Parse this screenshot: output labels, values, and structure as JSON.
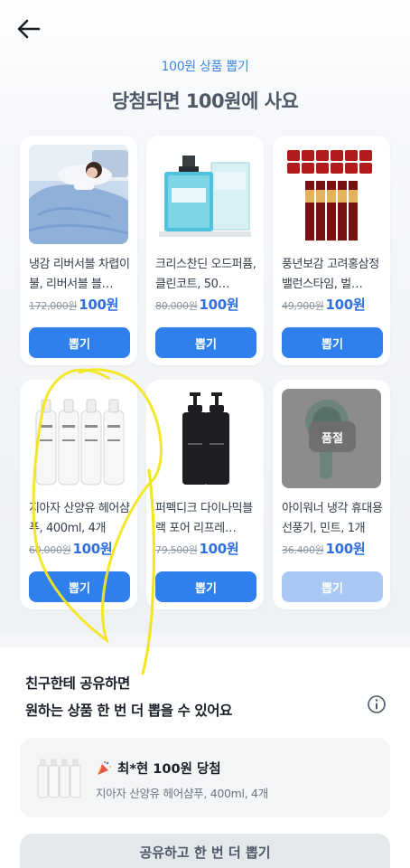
{
  "header": {
    "back_icon": "arrow-left-icon",
    "subtitle": "100원 상품 뽑기",
    "title": "당첨되면 100원에 사요"
  },
  "products": [
    {
      "name": "냉감 리버서블 차렵이불, 리버서블 블…",
      "original_price": "172,000원",
      "sale_price": "100원",
      "button": "뽑기",
      "sold_out": false
    },
    {
      "name": "크리스찬딘 오드퍼퓸, 클린코트, 50…",
      "original_price": "80,000원",
      "sale_price": "100원",
      "button": "뽑기",
      "sold_out": false
    },
    {
      "name": "풍년보감 고려홍삼정 밸런스타임, 벌…",
      "original_price": "49,900원",
      "sale_price": "100원",
      "button": "뽑기",
      "sold_out": false
    },
    {
      "name": "지아자 산양유 헤어샴푸, 400ml, 4개",
      "original_price": "60,000원",
      "sale_price": "100원",
      "button": "뽑기",
      "sold_out": false
    },
    {
      "name": "퍼펙디크 다이나믹블랙 포어 리프레…",
      "original_price": "79,500원",
      "sale_price": "100원",
      "button": "뽑기",
      "sold_out": false
    },
    {
      "name": "아이워너 냉각 휴대용 선풍기, 민트, 1개",
      "original_price": "36,400원",
      "sale_price": "100원",
      "button": "뽑기",
      "sold_out": true,
      "sold_out_label": "품절"
    }
  ],
  "share": {
    "line1": "친구한테 공유하면",
    "line2": "원하는 상품 한 번 더 뽑을 수 있어요",
    "info_icon": "info-circle-icon",
    "winner": {
      "emoji_icon": "party-popper-icon",
      "title": "최*현 100원 당첨",
      "product": "지아자 산양유 헤어샴푸, 400ml, 4개"
    },
    "button": "공유하고 한 번 더 뽑기"
  },
  "colors": {
    "accent": "#2f80ed",
    "accent_disabled": "#a9c9f4",
    "price": "#2f6fe0",
    "scribble": "#f3e51c"
  }
}
